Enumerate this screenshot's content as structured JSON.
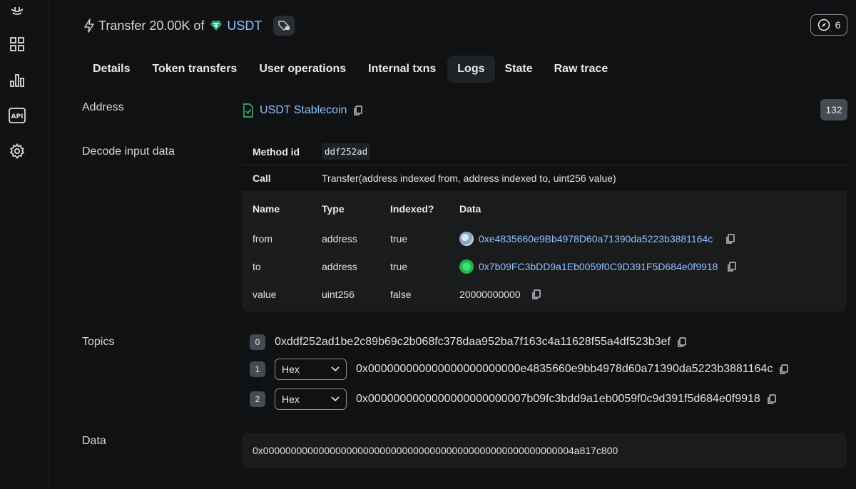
{
  "header": {
    "title_prefix": "Transfer 20.00K of",
    "token_name": "USDT",
    "counter": "6"
  },
  "tabs": [
    {
      "label": "Details"
    },
    {
      "label": "Token transfers"
    },
    {
      "label": "User operations"
    },
    {
      "label": "Internal txns"
    },
    {
      "label": "Logs",
      "active": true
    },
    {
      "label": "State"
    },
    {
      "label": "Raw trace"
    }
  ],
  "log": {
    "address_label": "Address",
    "address_name": "USDT Stablecoin",
    "log_index": "132",
    "decode_label": "Decode input data",
    "method_id_label": "Method id",
    "method_id": "ddf252ad",
    "call_label": "Call",
    "call": "Transfer(address indexed from, address indexed to, uint256 value)",
    "columns": [
      "Name",
      "Type",
      "Indexed?",
      "Data"
    ],
    "params": [
      {
        "name": "from",
        "type": "address",
        "indexed": "true",
        "data": "0xe4835660e9Bb4978D60a71390da5223b3881164c"
      },
      {
        "name": "to",
        "type": "address",
        "indexed": "true",
        "data": "0x7b09FC3bDD9a1Eb0059f0C9D391F5D684e0f9918"
      },
      {
        "name": "value",
        "type": "uint256",
        "indexed": "false",
        "data": "20000000000"
      }
    ],
    "topics_label": "Topics",
    "topics": [
      {
        "index": "0",
        "value": "0xddf252ad1be2c89b69c2b068fc378daa952ba7f163c4a11628f55a4df523b3ef"
      },
      {
        "index": "1",
        "format": "Hex",
        "value": "0x000000000000000000000000e4835660e9bb4978d60a71390da5223b3881164c"
      },
      {
        "index": "2",
        "format": "Hex",
        "value": "0x0000000000000000000000007b09fc3bdd9a1eb0059f0c9d391f5d684e0f9918"
      }
    ],
    "data_label": "Data",
    "data": "0x00000000000000000000000000000000000000000000000000000004a817c800"
  },
  "colors": {
    "background": "#101112",
    "link": "#8ec0ff",
    "panel": "#191b1d",
    "tether": "#26a17b"
  }
}
